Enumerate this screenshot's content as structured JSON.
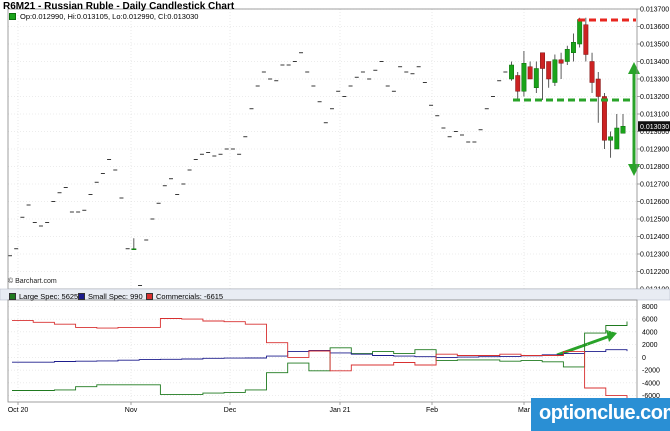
{
  "title": "R6M21 - Russian Ruble - Daily Candlestick Chart",
  "ohlc_readout": "Op:0.012990, Hi:0.013105, Lo:0.012990, Cl:0.013030",
  "credit": "© Barchart.com",
  "watermark": "optionclue.com",
  "colors": {
    "bull": "#1aa31a",
    "bear": "#cc2222",
    "annotation_green": "#29a329",
    "annotation_red": "#e8261f",
    "large_spec": "#1f7a1f",
    "small_spec": "#1c1c8c",
    "commercials": "#d83030",
    "watermark_bg": "#2a8fd4"
  },
  "chart_data": [
    {
      "type": "candlestick",
      "title": "R6M21 - Russian Ruble - Daily Candlestick Chart",
      "ylim": [
        0.0121,
        0.0137
      ],
      "yticks": [
        "0.012100",
        "0.012200",
        "0.012300",
        "0.012400",
        "0.012500",
        "0.012600",
        "0.012700",
        "0.012800",
        "0.012900",
        "0.013000",
        "0.013100",
        "0.013200",
        "0.013300",
        "0.013400",
        "0.013500",
        "0.013600",
        "0.013700"
      ],
      "last_price_label": "0.013030",
      "xticks": [
        "Oct 20",
        "Nov",
        "Dec",
        "Jan 21",
        "Feb",
        "Mar"
      ],
      "candles": [
        [
          0.01229,
          0.01229,
          0.01229,
          0.01229
        ],
        [
          0.01233,
          0.01233,
          0.01233,
          0.01233
        ],
        [
          0.01251,
          0.01251,
          0.01251,
          0.01251
        ],
        [
          0.01258,
          0.01258,
          0.01258,
          0.01258
        ],
        [
          0.01248,
          0.01248,
          0.01248,
          0.01248
        ],
        [
          0.01246,
          0.01246,
          0.01246,
          0.01246
        ],
        [
          0.01248,
          0.01248,
          0.01248,
          0.01248
        ],
        [
          0.0126,
          0.0126,
          0.0126,
          0.0126
        ],
        [
          0.01265,
          0.01265,
          0.01265,
          0.01265
        ],
        [
          0.01268,
          0.01268,
          0.01268,
          0.01268
        ],
        [
          0.01254,
          0.01254,
          0.01254,
          0.01254
        ],
        [
          0.01254,
          0.01254,
          0.01254,
          0.01254
        ],
        [
          0.01255,
          0.01255,
          0.01255,
          0.01255
        ],
        [
          0.01264,
          0.01264,
          0.01264,
          0.01264
        ],
        [
          0.01271,
          0.01271,
          0.01271,
          0.01271
        ],
        [
          0.01276,
          0.01276,
          0.01276,
          0.01276
        ],
        [
          0.01284,
          0.01284,
          0.01284,
          0.01284
        ],
        [
          0.01278,
          0.01278,
          0.01278,
          0.01278
        ],
        [
          0.01262,
          0.01262,
          0.01262,
          0.01262
        ],
        [
          0.01233,
          0.01233,
          0.01233,
          0.01233
        ],
        [
          0.01233,
          0.01239,
          0.01233,
          0.01233
        ],
        [
          0.01212,
          0.01212,
          0.01212,
          0.01212
        ],
        [
          0.01238,
          0.01238,
          0.01238,
          0.01238
        ],
        [
          0.0125,
          0.0125,
          0.0125,
          0.0125
        ],
        [
          0.01259,
          0.01259,
          0.01259,
          0.01259
        ],
        [
          0.01269,
          0.01269,
          0.01269,
          0.01269
        ],
        [
          0.01273,
          0.01273,
          0.01273,
          0.01273
        ],
        [
          0.01264,
          0.01264,
          0.01264,
          0.01264
        ],
        [
          0.0127,
          0.0127,
          0.0127,
          0.0127
        ],
        [
          0.01278,
          0.01278,
          0.01278,
          0.01278
        ],
        [
          0.01284,
          0.01284,
          0.01284,
          0.01284
        ],
        [
          0.01287,
          0.01287,
          0.01287,
          0.01287
        ],
        [
          0.01288,
          0.01288,
          0.01288,
          0.01288
        ],
        [
          0.01286,
          0.01286,
          0.01286,
          0.01286
        ],
        [
          0.01287,
          0.01287,
          0.01287,
          0.01287
        ],
        [
          0.0129,
          0.0129,
          0.0129,
          0.0129
        ],
        [
          0.0129,
          0.0129,
          0.0129,
          0.0129
        ],
        [
          0.01287,
          0.01287,
          0.01287,
          0.01287
        ],
        [
          0.01297,
          0.01297,
          0.01297,
          0.01297
        ],
        [
          0.01313,
          0.01313,
          0.01313,
          0.01313
        ],
        [
          0.01326,
          0.01326,
          0.01326,
          0.01326
        ],
        [
          0.01334,
          0.01334,
          0.01334,
          0.01334
        ],
        [
          0.0133,
          0.0133,
          0.0133,
          0.0133
        ],
        [
          0.01329,
          0.01329,
          0.01329,
          0.01329
        ],
        [
          0.01338,
          0.01338,
          0.01338,
          0.01338
        ],
        [
          0.01338,
          0.01338,
          0.01338,
          0.01338
        ],
        [
          0.0134,
          0.0134,
          0.0134,
          0.0134
        ],
        [
          0.01345,
          0.01345,
          0.01345,
          0.01345
        ],
        [
          0.01334,
          0.01334,
          0.01334,
          0.01334
        ],
        [
          0.01326,
          0.01326,
          0.01326,
          0.01326
        ],
        [
          0.01317,
          0.01317,
          0.01317,
          0.01317
        ],
        [
          0.01305,
          0.01305,
          0.01305,
          0.01305
        ],
        [
          0.01313,
          0.01313,
          0.01313,
          0.01313
        ],
        [
          0.01323,
          0.01323,
          0.01323,
          0.01323
        ],
        [
          0.0132,
          0.0132,
          0.0132,
          0.0132
        ],
        [
          0.01326,
          0.01326,
          0.01326,
          0.01326
        ],
        [
          0.01331,
          0.01331,
          0.01331,
          0.01331
        ],
        [
          0.01334,
          0.01334,
          0.01334,
          0.01334
        ],
        [
          0.0133,
          0.0133,
          0.0133,
          0.0133
        ],
        [
          0.01335,
          0.01335,
          0.01335,
          0.01335
        ],
        [
          0.0134,
          0.0134,
          0.0134,
          0.0134
        ],
        [
          0.01326,
          0.01326,
          0.01326,
          0.01326
        ],
        [
          0.01323,
          0.01323,
          0.01323,
          0.01323
        ],
        [
          0.01337,
          0.01337,
          0.01337,
          0.01337
        ],
        [
          0.01334,
          0.01334,
          0.01334,
          0.01334
        ],
        [
          0.01333,
          0.01333,
          0.01333,
          0.01333
        ],
        [
          0.01337,
          0.01337,
          0.01337,
          0.01337
        ],
        [
          0.01328,
          0.01328,
          0.01328,
          0.01328
        ],
        [
          0.01315,
          0.01315,
          0.01315,
          0.01315
        ],
        [
          0.01309,
          0.01309,
          0.01309,
          0.01309
        ],
        [
          0.01302,
          0.01302,
          0.01302,
          0.01302
        ],
        [
          0.01297,
          0.01297,
          0.01297,
          0.01297
        ],
        [
          0.013,
          0.013,
          0.013,
          0.013
        ],
        [
          0.01298,
          0.01298,
          0.01298,
          0.01298
        ],
        [
          0.01294,
          0.01294,
          0.01294,
          0.01294
        ],
        [
          0.01294,
          0.01294,
          0.01294,
          0.01294
        ],
        [
          0.01301,
          0.01301,
          0.01301,
          0.01301
        ],
        [
          0.01313,
          0.01313,
          0.01313,
          0.01313
        ],
        [
          0.0132,
          0.0132,
          0.0132,
          0.0132
        ],
        [
          0.01329,
          0.01329,
          0.01329,
          0.01329
        ],
        [
          0.01334,
          0.01334,
          0.01334,
          0.01334
        ],
        [
          0.0133,
          0.0134,
          0.01329,
          0.01338
        ],
        [
          0.01332,
          0.01334,
          0.01318,
          0.01323
        ],
        [
          0.01323,
          0.01346,
          0.0132,
          0.01339
        ],
        [
          0.01337,
          0.0134,
          0.0133,
          0.0133
        ],
        [
          0.01325,
          0.0134,
          0.01322,
          0.01336
        ],
        [
          0.01345,
          0.01345,
          0.01318,
          0.01336
        ],
        [
          0.0134,
          0.0134,
          0.01325,
          0.0133
        ],
        [
          0.01328,
          0.01344,
          0.01326,
          0.01341
        ],
        [
          0.01341,
          0.01345,
          0.0133,
          0.01339
        ],
        [
          0.0134,
          0.01349,
          0.01338,
          0.01347
        ],
        [
          0.01345,
          0.01356,
          0.0134,
          0.01351
        ],
        [
          0.0135,
          0.01365,
          0.01348,
          0.01364
        ],
        [
          0.01361,
          0.01365,
          0.0134,
          0.01344
        ],
        [
          0.0134,
          0.01345,
          0.01322,
          0.01328
        ],
        [
          0.0133,
          0.01334,
          0.01305,
          0.0132
        ],
        [
          0.0132,
          0.01322,
          0.0129,
          0.01295
        ],
        [
          0.01295,
          0.013,
          0.01285,
          0.01297
        ],
        [
          0.0129,
          0.0131,
          0.0129,
          0.01302
        ],
        [
          0.01299,
          0.0131,
          0.01299,
          0.01303
        ]
      ]
    },
    {
      "type": "line",
      "title": "",
      "ylim": [
        -7000,
        9000
      ],
      "yticks": [
        "8000",
        "6000",
        "4000",
        "2000",
        "0",
        "-2000",
        "-4000",
        "-6000"
      ],
      "series": [
        {
          "name": "Large Spec: 5625",
          "values": [
            -5200,
            -5200,
            -5100,
            -4600,
            -4300,
            -4300,
            -4300,
            -5800,
            -5800,
            -5600,
            -5500,
            -5100,
            -2400,
            -900,
            -2100,
            1500,
            600,
            900,
            600,
            1200,
            -500,
            -400,
            -400,
            -600,
            -500,
            -700,
            -1500,
            3800,
            5000,
            5625
          ]
        },
        {
          "name": "Small Spec: 990",
          "values": [
            -750,
            -750,
            -650,
            -600,
            -550,
            -450,
            -350,
            -300,
            -250,
            -150,
            -120,
            -100,
            200,
            900,
            1100,
            700,
            500,
            300,
            200,
            100,
            0,
            50,
            100,
            150,
            250,
            400,
            600,
            900,
            1200,
            990
          ]
        },
        {
          "name": "Commercials: -6615",
          "values": [
            5800,
            5500,
            5200,
            4700,
            4600,
            4700,
            4700,
            6100,
            6000,
            5700,
            5600,
            5200,
            2300,
            0,
            1000,
            -2100,
            -1200,
            -1200,
            -800,
            -1200,
            500,
            300,
            300,
            500,
            300,
            300,
            900,
            -4800,
            -6000,
            -6615
          ]
        }
      ]
    }
  ]
}
